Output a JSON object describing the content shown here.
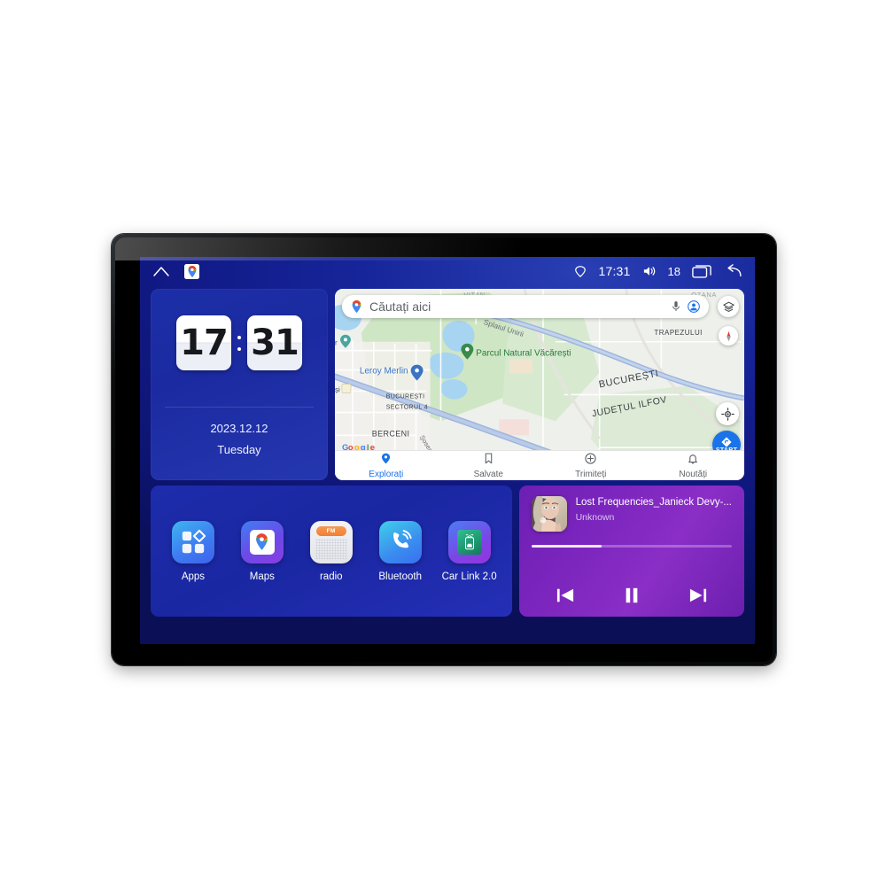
{
  "device": {
    "type": "car-head-unit-touchscreen"
  },
  "statusbar": {
    "home_icon": "home-icon",
    "maps_icon": "google-maps-icon",
    "gps_icon": "gps-location-icon",
    "time": "17:31",
    "volume_icon": "volume-icon",
    "volume_level": "18",
    "recents_icon": "recents-icon",
    "back_icon": "back-icon"
  },
  "clock_widget": {
    "hours": "17",
    "minutes": "31",
    "date": "2023.12.12",
    "weekday": "Tuesday"
  },
  "map_widget": {
    "search": {
      "placeholder": "Căutați aici",
      "value": "Căutați aici"
    },
    "mic_icon": "microphone-icon",
    "account_icon": "account-avatar-icon",
    "layers_icon": "map-layers-icon",
    "compass_icon": "compass-icon",
    "locate_icon": "my-location-icon",
    "start_button_label": "START",
    "attribution": "Google",
    "labels": [
      "VITAN",
      "OZANA",
      "TRAPEZULUI",
      "Splaiul Unirii",
      "Parcul Natural Văcărești",
      "BUCUREȘTI",
      "JUDEȚUL ILFOV",
      "Leroy Merlin",
      "BUCUREȘTI SECTORUL 4",
      "BERCENI",
      "Șoseaua Br"
    ],
    "nav": [
      {
        "label": "Explorați",
        "icon": "explore-pin-icon",
        "active": true
      },
      {
        "label": "Salvate",
        "icon": "bookmark-icon",
        "active": false
      },
      {
        "label": "Trimiteți",
        "icon": "contribute-icon",
        "active": false
      },
      {
        "label": "Noutăți",
        "icon": "bell-icon",
        "active": false
      }
    ]
  },
  "dock": {
    "apps": [
      {
        "label": "Apps",
        "icon": "apps-grid-icon"
      },
      {
        "label": "Maps",
        "icon": "google-maps-icon"
      },
      {
        "label": "radio",
        "icon": "fm-radio-icon",
        "badge": "FM"
      },
      {
        "label": "Bluetooth",
        "icon": "bluetooth-phone-icon"
      },
      {
        "label": "Car Link 2.0",
        "icon": "car-link-icon"
      }
    ]
  },
  "player": {
    "title": "Lost Frequencies_Janieck Devy-...",
    "artist": "Unknown",
    "progress_percent": 35,
    "prev_icon": "previous-track-icon",
    "play_pause_icon": "pause-icon",
    "next_icon": "next-track-icon"
  },
  "colors": {
    "desktop_blue": "#16259a",
    "card_blue": "#1c2fa8",
    "player_purple": "#7a25bd",
    "accent_google_blue": "#1a73e8"
  }
}
